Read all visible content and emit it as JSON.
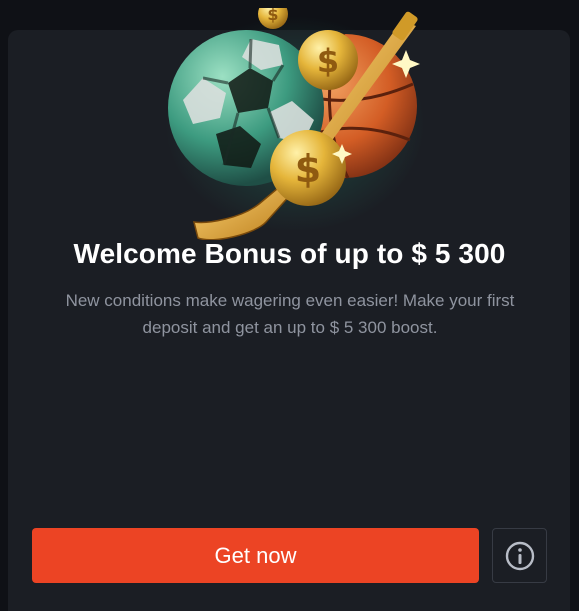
{
  "bonus": {
    "title": "Welcome Bonus of up to $ 5 300",
    "description": "New conditions make wagering even easier! Make your first deposit and get an up to $ 5 300 boost."
  },
  "actions": {
    "primary_label": "Get now",
    "info_icon": "info-circle-icon"
  },
  "colors": {
    "background": "#0f1116",
    "card": "#1b1e24",
    "accent": "#ec4424",
    "title": "#ffffff",
    "description": "#8f949f",
    "info_border": "#373b44"
  },
  "illustration": {
    "items": [
      "soccer-ball-icon",
      "basketball-icon",
      "hockey-stick-icon",
      "dollar-coin-icon"
    ]
  }
}
